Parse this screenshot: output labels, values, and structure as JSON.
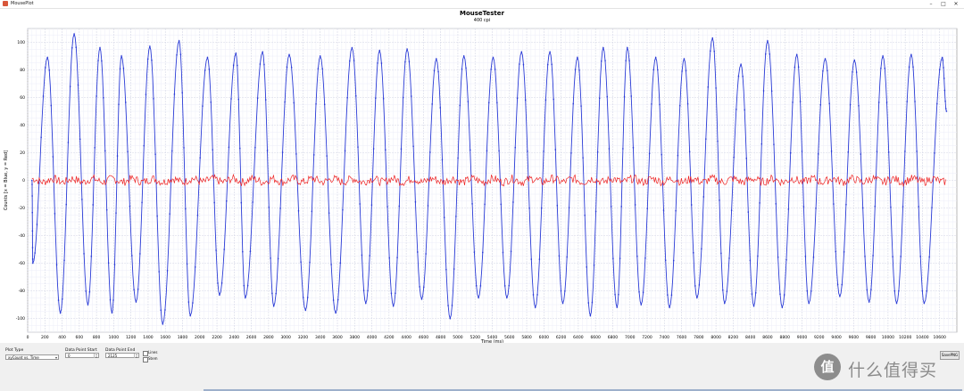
{
  "window": {
    "title": "MousePlot",
    "minimize_glyph": "–",
    "maximize_glyph": "□",
    "close_glyph": "✕"
  },
  "controls": {
    "plot_type_label": "Plot Type",
    "plot_type_value": "xyCount vs. Time",
    "start_label": "Data Point Start",
    "start_value": "0",
    "end_label": "Data Point End",
    "end_value": "2125",
    "lines_label": "Lines",
    "lines_checked": false,
    "stem_label": "Stem",
    "stem_checked": false,
    "save_label": "SavePNG"
  },
  "watermark": {
    "logo_glyph": "值",
    "text": "什么值得买"
  },
  "chart_data": {
    "type": "line",
    "title": "MouseTester",
    "subtitle": "400 cpi",
    "xlabel": "Time (ms)",
    "ylabel": "Counts [x = Blue, y = Red]",
    "xlim": [
      0,
      10800
    ],
    "ylim": [
      -110,
      110
    ],
    "xticks": [
      0,
      200,
      400,
      600,
      800,
      1000,
      1200,
      1400,
      1600,
      1800,
      2000,
      2200,
      2400,
      2600,
      2800,
      3000,
      3200,
      3400,
      3600,
      3800,
      4000,
      4200,
      4400,
      4600,
      4800,
      5000,
      5200,
      5400,
      5600,
      5800,
      6000,
      6200,
      6400,
      6600,
      6800,
      7000,
      7200,
      7400,
      7600,
      7800,
      8000,
      8200,
      8400,
      8600,
      8800,
      9000,
      9200,
      9400,
      9600,
      9800,
      10000,
      10200,
      10400,
      10600
    ],
    "yticks": [
      -100,
      -80,
      -60,
      -40,
      -20,
      0,
      20,
      40,
      60,
      80,
      100
    ],
    "grid": true,
    "series": [
      {
        "name": "x",
        "color": "#2a3bd6",
        "comment_free": true,
        "peaks_x": [
          230,
          540,
          840,
          1090,
          1420,
          1760,
          2090,
          2420,
          2730,
          3040,
          3400,
          3770,
          4090,
          4410,
          4750,
          5070,
          5410,
          5740,
          6070,
          6390,
          6690,
          6970,
          7300,
          7630,
          7960,
          8290,
          8600,
          8940,
          9270,
          9610,
          9940,
          10270,
          10630
        ],
        "peaks_y": [
          89,
          106,
          96,
          90,
          97,
          101,
          89,
          92,
          93,
          91,
          90,
          96,
          94,
          95,
          88,
          90,
          89,
          93,
          93,
          89,
          96,
          96,
          89,
          88,
          103,
          84,
          101,
          91,
          88,
          87,
          90,
          91,
          89
        ],
        "troughs_x": [
          60,
          380,
          700,
          980,
          1260,
          1570,
          1890,
          2230,
          2530,
          2860,
          3230,
          3580,
          3930,
          4250,
          4580,
          4910,
          5240,
          5570,
          5900,
          6220,
          6540,
          6850,
          7130,
          7460,
          7780,
          8100,
          8440,
          8770,
          9080,
          9440,
          9780,
          10100,
          10420
        ],
        "troughs_y": [
          -60,
          -96,
          -90,
          -96,
          -88,
          -104,
          -98,
          -83,
          -85,
          -91,
          -94,
          -96,
          -89,
          -91,
          -86,
          -100,
          -85,
          -85,
          -92,
          -89,
          -98,
          -92,
          -90,
          -92,
          -85,
          -89,
          -91,
          -92,
          -89,
          -84,
          -88,
          -89,
          -89
        ]
      },
      {
        "name": "y",
        "color": "#ee2020",
        "mean": 0,
        "amplitude": 3
      }
    ]
  }
}
